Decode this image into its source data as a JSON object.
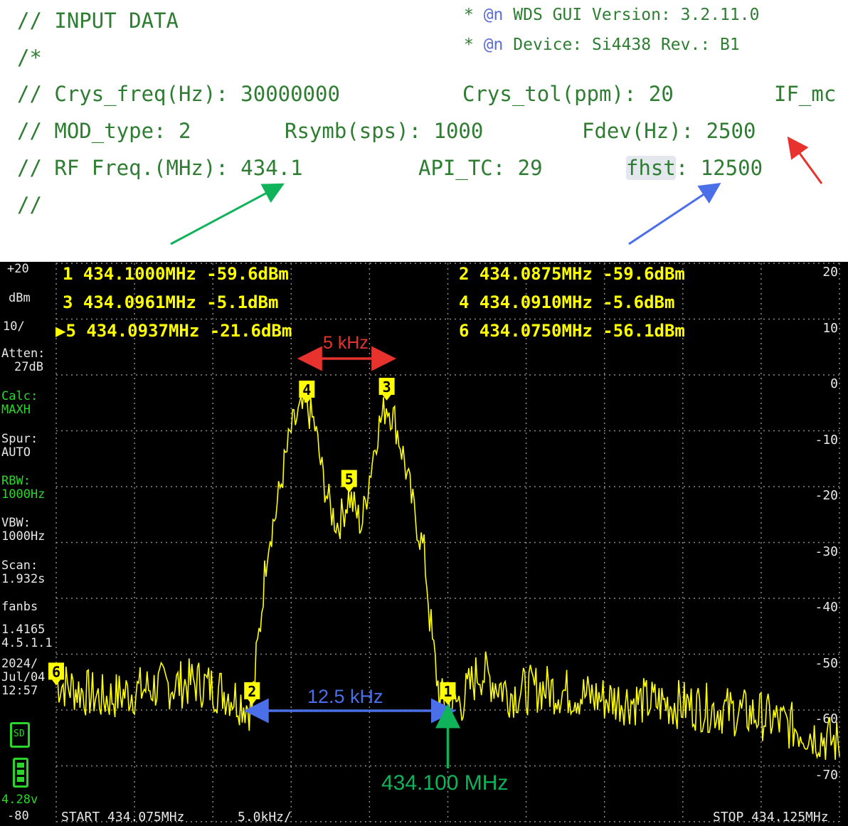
{
  "code": {
    "header": [
      {
        "prefix": "* ",
        "at": "@n",
        "text": " WDS GUI Version: 3.2.11.0"
      },
      {
        "prefix": "* ",
        "at": "@n",
        "text": " Device: Si4438 Rev.: B1"
      }
    ],
    "lines": {
      "l1": "// INPUT DATA",
      "l2": "/*",
      "l3a": "// Crys_freq(Hz): 30000000",
      "l3b": "Crys_tol(ppm): 20",
      "l3c": "IF_mc",
      "l4a": "// MOD_type: 2",
      "l4b": "Rsymb(sps): 1000",
      "l4c": "Fdev(Hz): 2500",
      "l5a": "// RF Freq.(MHz): 434.1",
      "l5b": "API_TC: 29",
      "l5c_hl": "fhst",
      "l5c_rest": ": 12500",
      "l6": "//"
    }
  },
  "analyzer": {
    "ref_level": "+20",
    "unit": "dBm",
    "scale": "10/",
    "atten_label": "Atten:",
    "atten_value": "27dB",
    "calc_label": "Calc:",
    "calc_value": "MAXH",
    "spur_label": "Spur:",
    "spur_value": "AUTO",
    "rbw_label": "RBW:",
    "rbw_value": "1000Hz",
    "vbw_label": "VBW:",
    "vbw_value": "1000Hz",
    "scan_label": "Scan:",
    "scan_value": "1.932s",
    "device": "fanbs",
    "version1": "1.4165",
    "version2": "4.5.1.1",
    "date1": "2024/",
    "date2": "Jul/04",
    "time": "12:57",
    "sd_label": "SD",
    "battery_voltage": "4.28v",
    "bottom_level": "-80",
    "start_label": "START 434.075MHz",
    "span_label": "5.0kHz/",
    "stop_label": "STOP 434.125MHz",
    "right_scale": [
      "20",
      "10",
      "0",
      "-10",
      "-20",
      "-30",
      "-40",
      "-50",
      "-60",
      "-70"
    ],
    "markers": [
      {
        "text": "1 434.1000MHz -59.6dBm"
      },
      {
        "text": "2 434.0875MHz -59.6dBm"
      },
      {
        "text": "3 434.0961MHz -5.1dBm"
      },
      {
        "text": "4 434.0910MHz -5.6dBm"
      },
      {
        "text": "▶5 434.0937MHz -21.6dBm"
      },
      {
        "text": "6 434.0750MHz -56.1dBm"
      }
    ],
    "marker_tags": [
      "1",
      "2",
      "3",
      "4",
      "5",
      "6"
    ]
  },
  "annotations": {
    "dev_label": "5 kHz",
    "spacing_label": "12.5 kHz",
    "center_label": "434.100 MHz",
    "colors": {
      "red": "#e8322d",
      "blue": "#4b6fe8",
      "green": "#11b35a",
      "trace": "#ffff00",
      "grid": "#8a8a8a"
    }
  },
  "chart_data": {
    "type": "line",
    "title": "",
    "xlabel": "",
    "ylabel": "dBm",
    "xlim": [
      434.075,
      434.125
    ],
    "ylim": [
      -80,
      20
    ],
    "x_unit": "MHz",
    "grid": true,
    "series": [
      {
        "x": [
          434.075,
          434.078,
          434.081,
          434.084,
          434.086,
          434.0875,
          434.088,
          434.0885,
          434.089,
          434.0895,
          434.09,
          434.0905,
          434.091,
          434.0915,
          434.092,
          434.0925,
          434.093,
          434.0937,
          434.0945,
          434.095,
          434.0955,
          434.0961,
          434.0966,
          434.0972,
          434.0978,
          434.0985,
          434.099,
          434.0995,
          434.1,
          434.101,
          434.102,
          434.104,
          434.106,
          434.108,
          434.11,
          434.115,
          434.12,
          434.125
        ],
        "values": [
          -55,
          -58,
          -56,
          -55,
          -57,
          -59.6,
          -45,
          -30,
          -25,
          -17,
          -10,
          -7,
          -5.6,
          -9,
          -18,
          -24,
          -27,
          -21.6,
          -27,
          -18,
          -10,
          -5.1,
          -8,
          -15,
          -24,
          -32,
          -48,
          -58,
          -59.6,
          -58,
          -53,
          -57,
          -56,
          -57,
          -58,
          -59,
          -61,
          -66
        ]
      }
    ],
    "markers": [
      {
        "id": 1,
        "x": 434.1,
        "y": -59.6
      },
      {
        "id": 2,
        "x": 434.0875,
        "y": -59.6
      },
      {
        "id": 3,
        "x": 434.0961,
        "y": -5.1
      },
      {
        "id": 4,
        "x": 434.091,
        "y": -5.6
      },
      {
        "id": 5,
        "x": 434.0937,
        "y": -21.6
      },
      {
        "id": 6,
        "x": 434.075,
        "y": -56.1
      }
    ]
  }
}
